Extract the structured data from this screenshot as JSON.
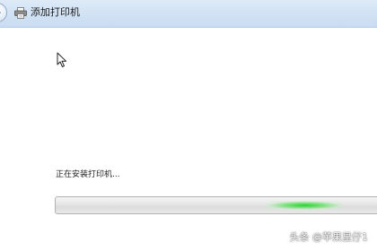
{
  "window": {
    "title": "添加打印机",
    "back_icon": "back-arrow-icon",
    "title_icon": "printer-icon"
  },
  "status": {
    "text": "正在安装打印机..."
  },
  "progress": {
    "state": "indeterminate",
    "glow_position_fraction": 0.76,
    "glow_color": "#1ed228"
  },
  "watermark": {
    "text": "头条 @苹果显仔1"
  },
  "colors": {
    "titlebar": "#d3e3f5",
    "background": "#ffffff"
  }
}
